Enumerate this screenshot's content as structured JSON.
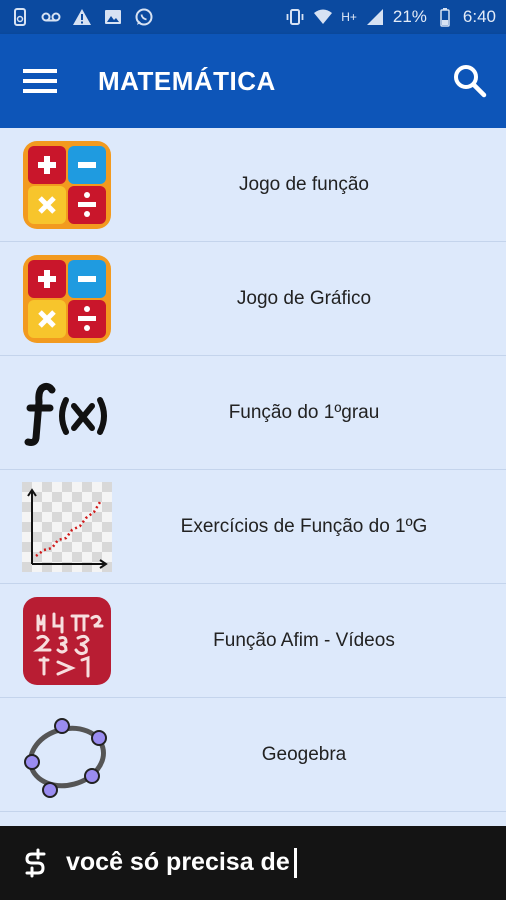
{
  "status_bar": {
    "battery_percent": "21%",
    "time": "6:40",
    "network_label": "H+",
    "left_icons": [
      "phone-sync-icon",
      "voicemail-icon",
      "warning-icon",
      "image-icon",
      "whatsapp-icon"
    ],
    "right_icons": [
      "vibrate-icon",
      "wifi-icon",
      "signal-icon",
      "battery-icon"
    ]
  },
  "app_bar": {
    "title": "MATEMÁTICA",
    "menu_icon": "hamburger-menu-icon",
    "search_icon": "search-icon",
    "background": "#0d55b8"
  },
  "list": {
    "items": [
      {
        "label": "Jogo de função",
        "icon": "math-operations-icon"
      },
      {
        "label": "Jogo de Gráfico",
        "icon": "math-operations-icon"
      },
      {
        "label": "Função do 1ºgrau",
        "icon": "fx-icon"
      },
      {
        "label": "Exercícios de Função do 1ºG",
        "icon": "graph-plot-icon"
      },
      {
        "label": "Função Afim - Vídeos",
        "icon": "math-blackboard-icon"
      },
      {
        "label": "Geogebra",
        "icon": "geogebra-icon"
      }
    ]
  },
  "banner": {
    "text": "você só precisa de"
  }
}
